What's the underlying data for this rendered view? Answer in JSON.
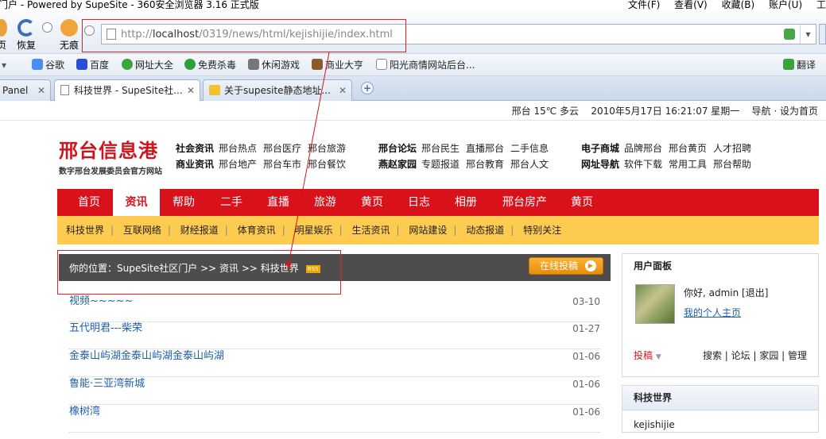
{
  "window": {
    "title": "门户 - Powered by SupeSite - 360安全浏览器 3.16 正式版",
    "menus": [
      "文件(F)",
      "查看(V)",
      "收藏(B)",
      "账户(U)",
      "工"
    ]
  },
  "toolbar": {
    "buttons": [
      "页",
      "恢复",
      "无痕"
    ]
  },
  "address": {
    "url_prefix": "http://",
    "url_host": "localhost",
    "url_path": "/0319/news/html/kejishijie/index.html"
  },
  "bookmarks": [
    "谷歌",
    "百度",
    "网址大全",
    "免费杀毒",
    "休闲游戏",
    "商业大亨",
    "阳光商情网站后台...",
    "翻译"
  ],
  "tabs": [
    {
      "label": "Panel"
    },
    {
      "label": "科技世界 - SupeSite社..."
    },
    {
      "label": "关于supesite静态地址..."
    }
  ],
  "weather": {
    "text": "邢台 15℃ 多云",
    "datetime": "2010年5月17日 16:21:07 星期一",
    "links": "导航 · 设为首页"
  },
  "logo": {
    "name": "邢台信息港",
    "slogan": "数字邢台发展委员会官方网站"
  },
  "topnav": {
    "col1": [
      {
        "head": "社会资讯",
        "items": [
          "邢台热点",
          "邢台医疗",
          "邢台旅游"
        ]
      },
      {
        "head": "商业资讯",
        "items": [
          "邢台地产",
          "邢台车市",
          "邢台餐饮"
        ]
      }
    ],
    "col2": [
      {
        "head": "邢台论坛",
        "items": [
          "邢台民生",
          "直播邢台",
          "二手信息"
        ]
      },
      {
        "head": "燕赵家园",
        "items": [
          "专题报道",
          "邢台教育",
          "邢台人文"
        ]
      }
    ],
    "col3": [
      {
        "head": "电子商城",
        "items": [
          "品牌邢台",
          "邢台黄页",
          "人才招聘"
        ]
      },
      {
        "head": "网址导航",
        "items": [
          "软件下载",
          "常用工具",
          "邢台帮助"
        ]
      }
    ]
  },
  "mainnav": [
    "首页",
    "资讯",
    "帮助",
    "二手",
    "直播",
    "旅游",
    "黄页",
    "日志",
    "相册",
    "邢台房产",
    "黄页"
  ],
  "mainnav_active": "资讯",
  "subnav": [
    "科技世界",
    "互联网络",
    "财经报道",
    "体育资讯",
    "明星娱乐",
    "生活资讯",
    "网站建设",
    "动态报道",
    "特别关注"
  ],
  "breadcrumb": {
    "text": "你的位置：SupeSite社区门户 >> 资讯 >> 科技世界",
    "rss": "RSS"
  },
  "submit_button": "在线投稿",
  "articles": [
    {
      "title": "视频~~~~~",
      "date": "03-10"
    },
    {
      "title": "五代明君---柴荣",
      "date": "01-27"
    },
    {
      "title": "金泰山屿湖金泰山屿湖金泰山屿湖",
      "date": "01-06"
    },
    {
      "title": "鲁能·三亚湾新城",
      "date": "01-06"
    },
    {
      "title": "橡树湾",
      "date": "01-06"
    }
  ],
  "userpanel": {
    "title": "用户面板",
    "greeting": "你好, admin [退出]",
    "home_link": "我的个人主页",
    "post": "投稿",
    "links": "搜索 | 论坛 | 家园 | 管理"
  },
  "techpanel": {
    "title": "科技世界",
    "body": "kejishijie"
  },
  "colors": {
    "brand_red": "#d9111a",
    "subnav_yellow": "#fdcb50",
    "link_blue": "#1f5ea8"
  }
}
